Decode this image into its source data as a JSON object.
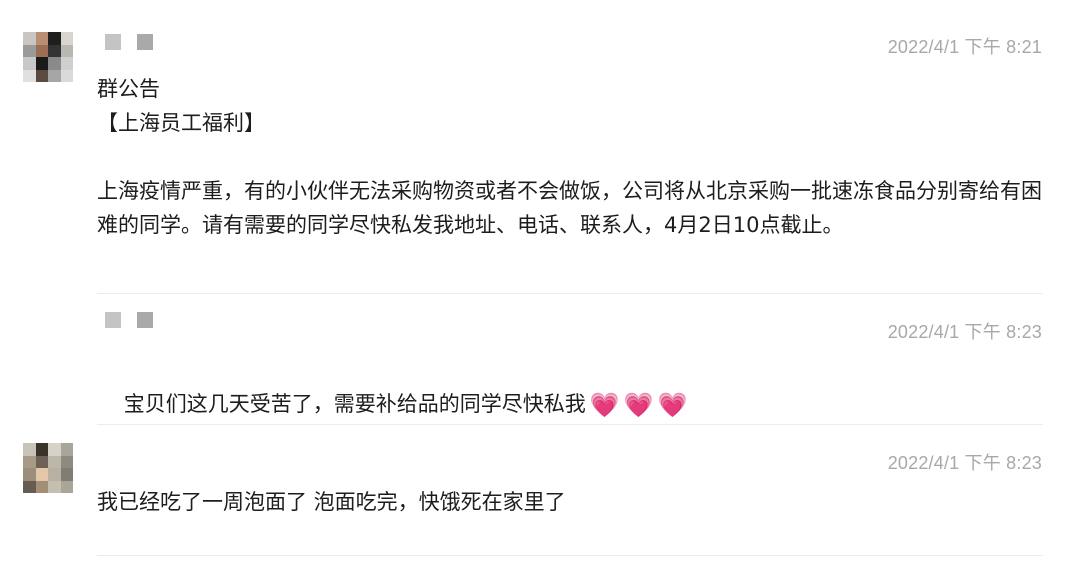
{
  "messages": [
    {
      "time": "2022/4/1 下午 8:21",
      "title": "群公告",
      "subtitle": "【上海员工福利】",
      "body": "上海疫情严重，有的小伙伴无法采购物资或者不会做饭，公司将从北京采购一批速冻食品分别寄给有困难的同学。请有需要的同学尽快私发我地址、电话、联系人，4月2日10点截止。"
    },
    {
      "time": "2022/4/1 下午 8:23",
      "body": "宝贝们这几天受苦了，需要补给品的同学尽快私我",
      "emojis": [
        "💗",
        "💗",
        "💗"
      ]
    },
    {
      "time": "2022/4/1 下午 8:23",
      "body": "我已经吃了一周泡面了 泡面吃完，快饿死在家里了"
    }
  ],
  "colors": {
    "timestamp": "#a8a8a8",
    "divider": "#ececec",
    "text": "#1d1d1d",
    "heart": "#e24aa0"
  }
}
